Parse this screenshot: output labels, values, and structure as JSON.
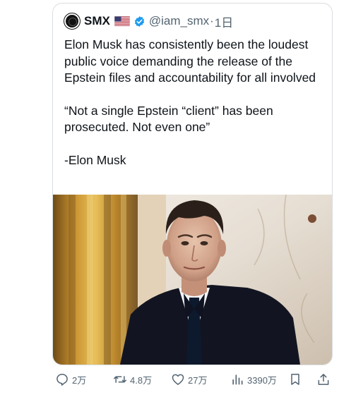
{
  "tweet": {
    "author_name": "SMX",
    "handle": "@iam_smx",
    "separator": "·",
    "time": "1日",
    "paragraphs": [
      "Elon Musk has consistently been the loudest public voice demanding the release of the Epstein files and accountability for all involved",
      "“Not a single Epstein “client” has been prosecuted. Not even one”",
      "-Elon Musk"
    ]
  },
  "actions": {
    "replies": "2万",
    "retweets": "4.8万",
    "likes": "27万",
    "views": "3390万"
  },
  "icons": {
    "avatar": "avatar-black-circle",
    "flag": "us-flag-icon",
    "verified": "verified-badge-icon",
    "reply": "reply-icon",
    "retweet": "retweet-icon",
    "like": "heart-icon",
    "views": "views-bar-chart-icon",
    "bookmark": "bookmark-icon",
    "share": "share-icon"
  },
  "colors": {
    "verified": "#1d9bf0",
    "muted_text": "#536471",
    "main_text": "#0f1419",
    "card_border": "#d9dde1"
  }
}
